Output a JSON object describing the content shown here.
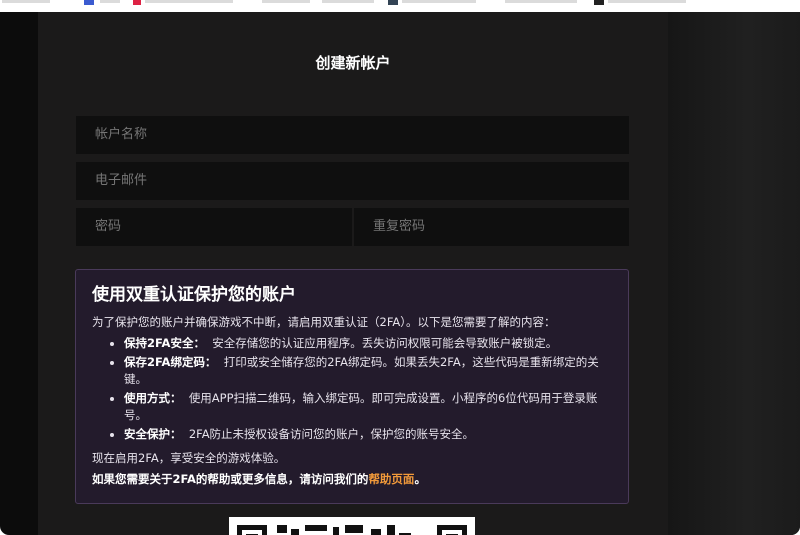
{
  "form": {
    "title": "创建新帐户",
    "account_name_placeholder": "帐户名称",
    "email_placeholder": "电子邮件",
    "password_placeholder": "密码",
    "repeat_password_placeholder": "重复密码"
  },
  "twofa": {
    "heading": "使用双重认证保护您的账户",
    "intro": "为了保护您的账户并确保游戏不中断，请启用双重认证（2FA）。以下是您需要了解的内容：",
    "items": [
      {
        "title": "保持2FA安全：",
        "text": "安全存储您的认证应用程序。丢失访问权限可能会导致账户被锁定。"
      },
      {
        "title": "保存2FA绑定码：",
        "text": "打印或安全储存您的2FA绑定码。如果丢失2FA，这些代码是重新绑定的关键。"
      },
      {
        "title": "使用方式：",
        "text": "使用APP扫描二维码，输入绑定码。即可完成设置。小程序的6位代码用于登录账号。"
      },
      {
        "title": "安全保护：",
        "text": "2FA防止未授权设备访问您的账户，保护您的账号安全。"
      }
    ],
    "closing": "现在启用2FA，享受安全的游戏体验。",
    "help_prefix": "如果您需要关于2FA的帮助或更多信息，请访问我们的",
    "help_link": "帮助页面",
    "help_suffix": "。"
  },
  "colors": {
    "accent_link": "#f29a3a",
    "info_background": "#231b2c",
    "page_background": "#1b1a1a"
  }
}
